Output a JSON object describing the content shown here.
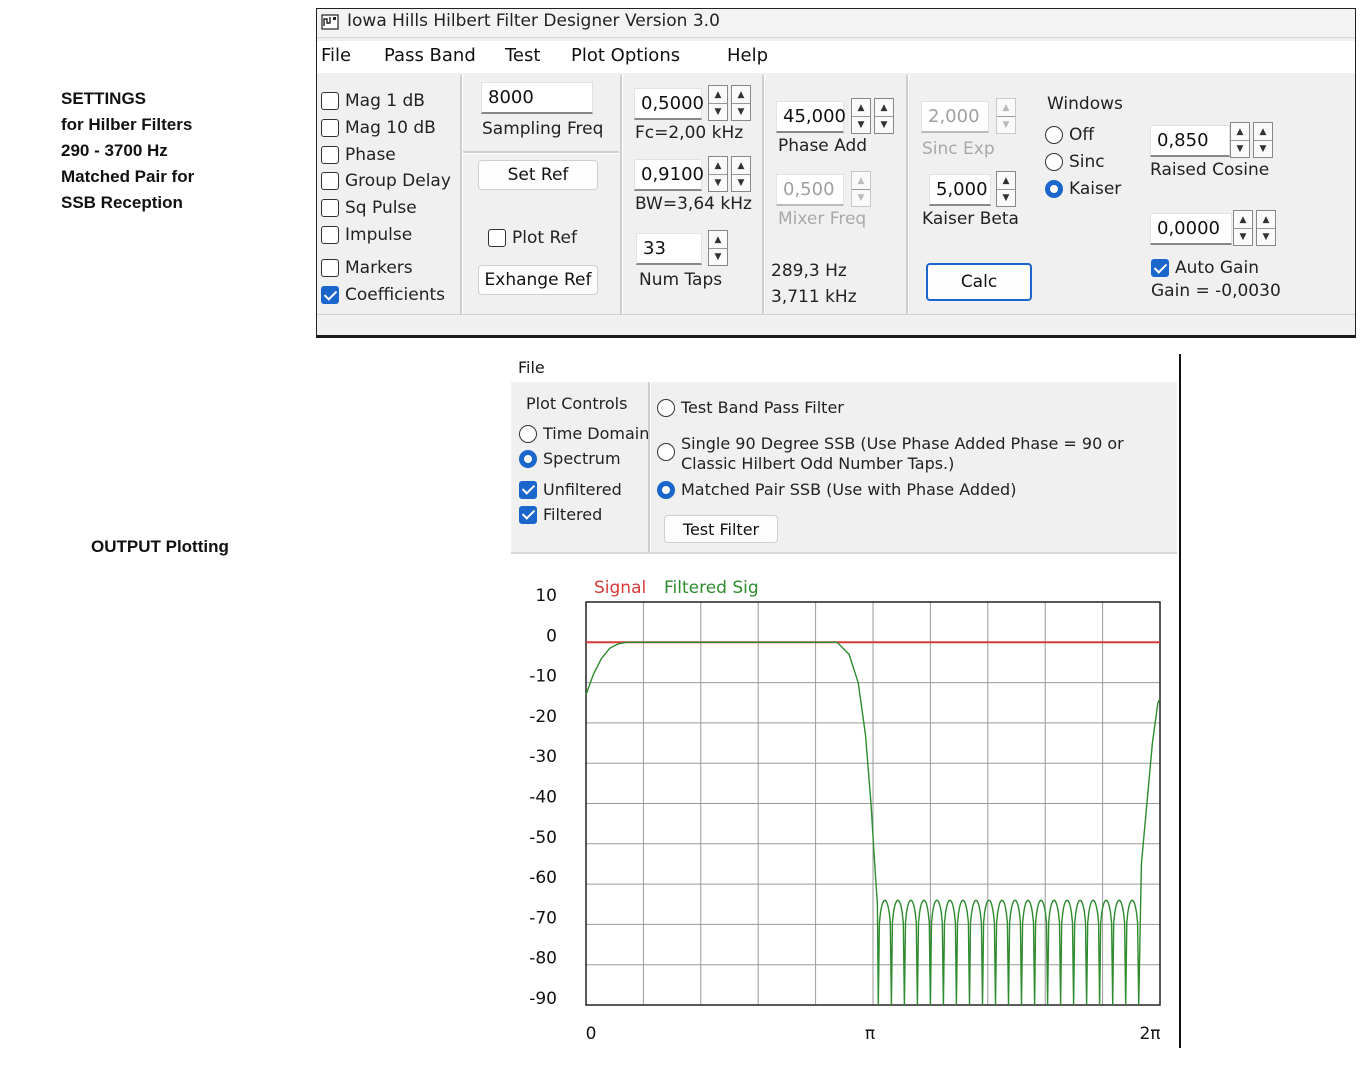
{
  "notes": {
    "settings": "SETTINGS\nfor Hilber Filters\n290 - 3700 Hz\nMatched Pair for\nSSB Reception",
    "output": "OUTPUT Plotting"
  },
  "window": {
    "title": "Iowa Hills Hilbert Filter Designer  Version 3.0",
    "app_icon": "app-filter-icon"
  },
  "menu": [
    "File",
    "Pass Band",
    "Test",
    "Plot Options",
    "Help"
  ],
  "display_checks": [
    {
      "label": "Mag   1 dB",
      "checked": false
    },
    {
      "label": "Mag 10 dB",
      "checked": false
    },
    {
      "label": "Phase",
      "checked": false
    },
    {
      "label": "Group Delay",
      "checked": false
    },
    {
      "label": "Sq Pulse",
      "checked": false
    },
    {
      "label": "Impulse",
      "checked": false
    },
    {
      "label": "Markers",
      "checked": false
    },
    {
      "label": "Coefficients",
      "checked": true
    }
  ],
  "sampling": {
    "value": "8000",
    "label": "Sampling Freq"
  },
  "ref": {
    "set_ref": "Set Ref",
    "plot_ref": "Plot Ref",
    "plot_ref_checked": false,
    "exchange_ref": "Exhange Ref"
  },
  "fc": {
    "value": "0,5000",
    "label": "Fc=2,00 kHz"
  },
  "bw": {
    "value": "0,9100",
    "label": "BW=3,64 kHz"
  },
  "taps": {
    "value": "33",
    "label": "Num Taps"
  },
  "phase_add": {
    "value": "45,000",
    "label": "Phase Add"
  },
  "mixer": {
    "value": "0,500",
    "label": "Mixer Freq",
    "enabled": false
  },
  "band_edges": {
    "low": "289,3 Hz",
    "high": "3,711 kHz"
  },
  "sinc_exp": {
    "value": "2,000",
    "label": "Sinc Exp",
    "enabled": false
  },
  "kaiser_beta": {
    "value": "5,000",
    "label": "Kaiser Beta"
  },
  "calc_button": "Calc",
  "windows": {
    "title": "Windows",
    "options": [
      {
        "label": "Off",
        "selected": false
      },
      {
        "label": "Sinc",
        "selected": false
      },
      {
        "label": "Kaiser",
        "selected": true
      }
    ]
  },
  "raised_cosine": {
    "value": "0,850",
    "label": "Raised Cosine"
  },
  "gain": {
    "value": "0,0000",
    "auto_label": "Auto Gain",
    "auto_checked": true,
    "readout": "Gain = -0,0030"
  },
  "plot_window": {
    "menu_file": "File",
    "plot_controls": {
      "title": "Plot Controls",
      "domains": [
        {
          "label": "Time Domain",
          "selected": false
        },
        {
          "label": "Spectrum",
          "selected": true
        }
      ],
      "checks": [
        {
          "label": "Unfiltered",
          "checked": true
        },
        {
          "label": "Filtered",
          "checked": true
        }
      ]
    },
    "tests": [
      {
        "label": "Test Band Pass Filter",
        "selected": false
      },
      {
        "label": "Single 90 Degree SSB  (Use Phase Added  Phase = 90   or",
        "label2": "Classic Hilbert    Odd Number Taps.)",
        "selected": false
      },
      {
        "label": "Matched Pair SSB  (Use with Phase Added)",
        "selected": true
      }
    ],
    "test_button": "Test Filter"
  },
  "chart_data": {
    "type": "line",
    "title": "",
    "xlabel": "",
    "ylabel": "",
    "x_ticks": [
      "0",
      "π",
      "2π"
    ],
    "y_ticks": [
      "10",
      "0",
      "-10",
      "-20",
      "-30",
      "-40",
      "-50",
      "-60",
      "-70",
      "-80",
      "-90"
    ],
    "xlim": [
      0,
      6.2832
    ],
    "ylim": [
      -90,
      10
    ],
    "grid": true,
    "legend_position": "top-left",
    "series": [
      {
        "name": "Signal",
        "color": "#d83a3a",
        "x": [
          0,
          6.2832
        ],
        "y": [
          0,
          0
        ]
      },
      {
        "name": "Filtered Sig",
        "color": "#2e8b2e",
        "x": [
          0,
          0.08,
          0.17,
          0.26,
          0.35,
          0.44,
          0.55,
          2.75,
          2.88,
          2.98,
          3.06,
          3.12,
          3.16,
          3.19,
          3.22,
          3.26,
          6.02,
          6.08,
          6.14,
          6.2,
          6.26,
          6.2832
        ],
        "y": [
          -13,
          -8,
          -4,
          -1.5,
          -0.4,
          0,
          0,
          0,
          -3,
          -10,
          -23,
          -40,
          -55,
          -65,
          -66,
          -64,
          -64,
          -55,
          -40,
          -25,
          -15,
          -14
        ],
        "stopband_lobes": {
          "from": 3.2,
          "to": 6.05,
          "count": 20,
          "peak": -64,
          "floor": -90
        }
      }
    ]
  }
}
